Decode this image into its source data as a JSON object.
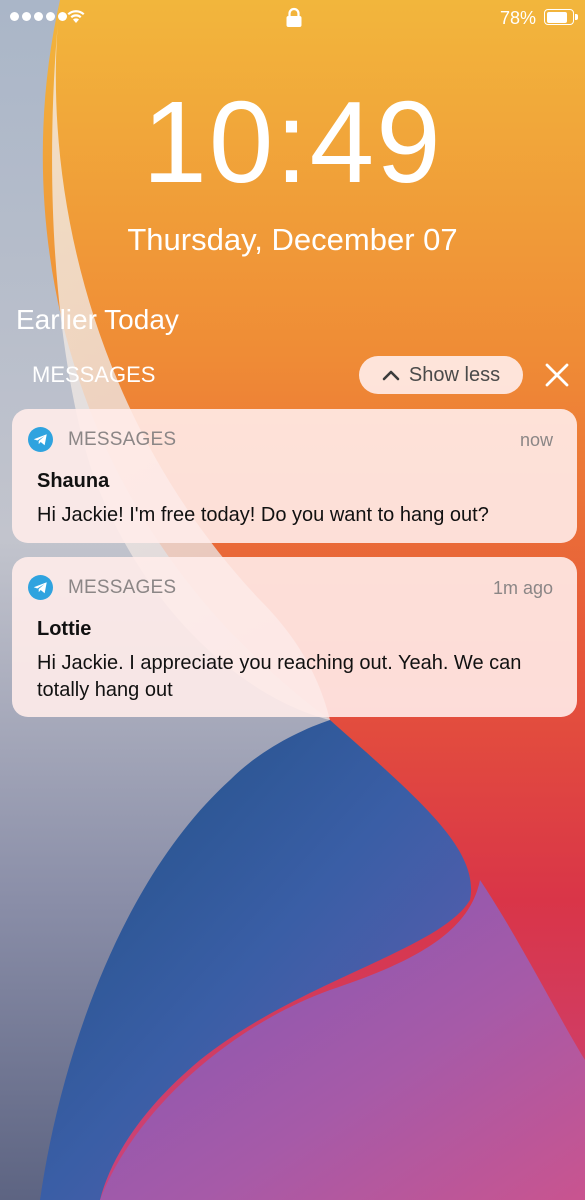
{
  "status_bar": {
    "signal_dots": 5,
    "wifi_icon": "wifi-icon",
    "lock_icon": "lock-icon",
    "battery_percent": "78%",
    "battery_level": 0.78
  },
  "lock_screen": {
    "time": "10:49",
    "date": "Thursday, December 07"
  },
  "notifications": {
    "section_title": "Earlier Today",
    "group_label": "MESSAGES",
    "show_less_label": "Show less",
    "show_less_icon": "chevron-up-icon",
    "close_icon": "close-icon",
    "items": [
      {
        "app_name": "MESSAGES",
        "app_icon": "telegram-icon",
        "timestamp": "now",
        "sender": "Shauna",
        "message": "Hi Jackie! I'm free today! Do you want to hang out?"
      },
      {
        "app_name": "MESSAGES",
        "app_icon": "telegram-icon",
        "timestamp": "1m ago",
        "sender": "Lottie",
        "message": "Hi Jackie. I appreciate you reaching out. Yeah. We can totally hang out"
      }
    ]
  },
  "colors": {
    "icon_blue": "#2fa3df",
    "card_background": "#ffecea",
    "secondary_text": "#8b8686"
  }
}
